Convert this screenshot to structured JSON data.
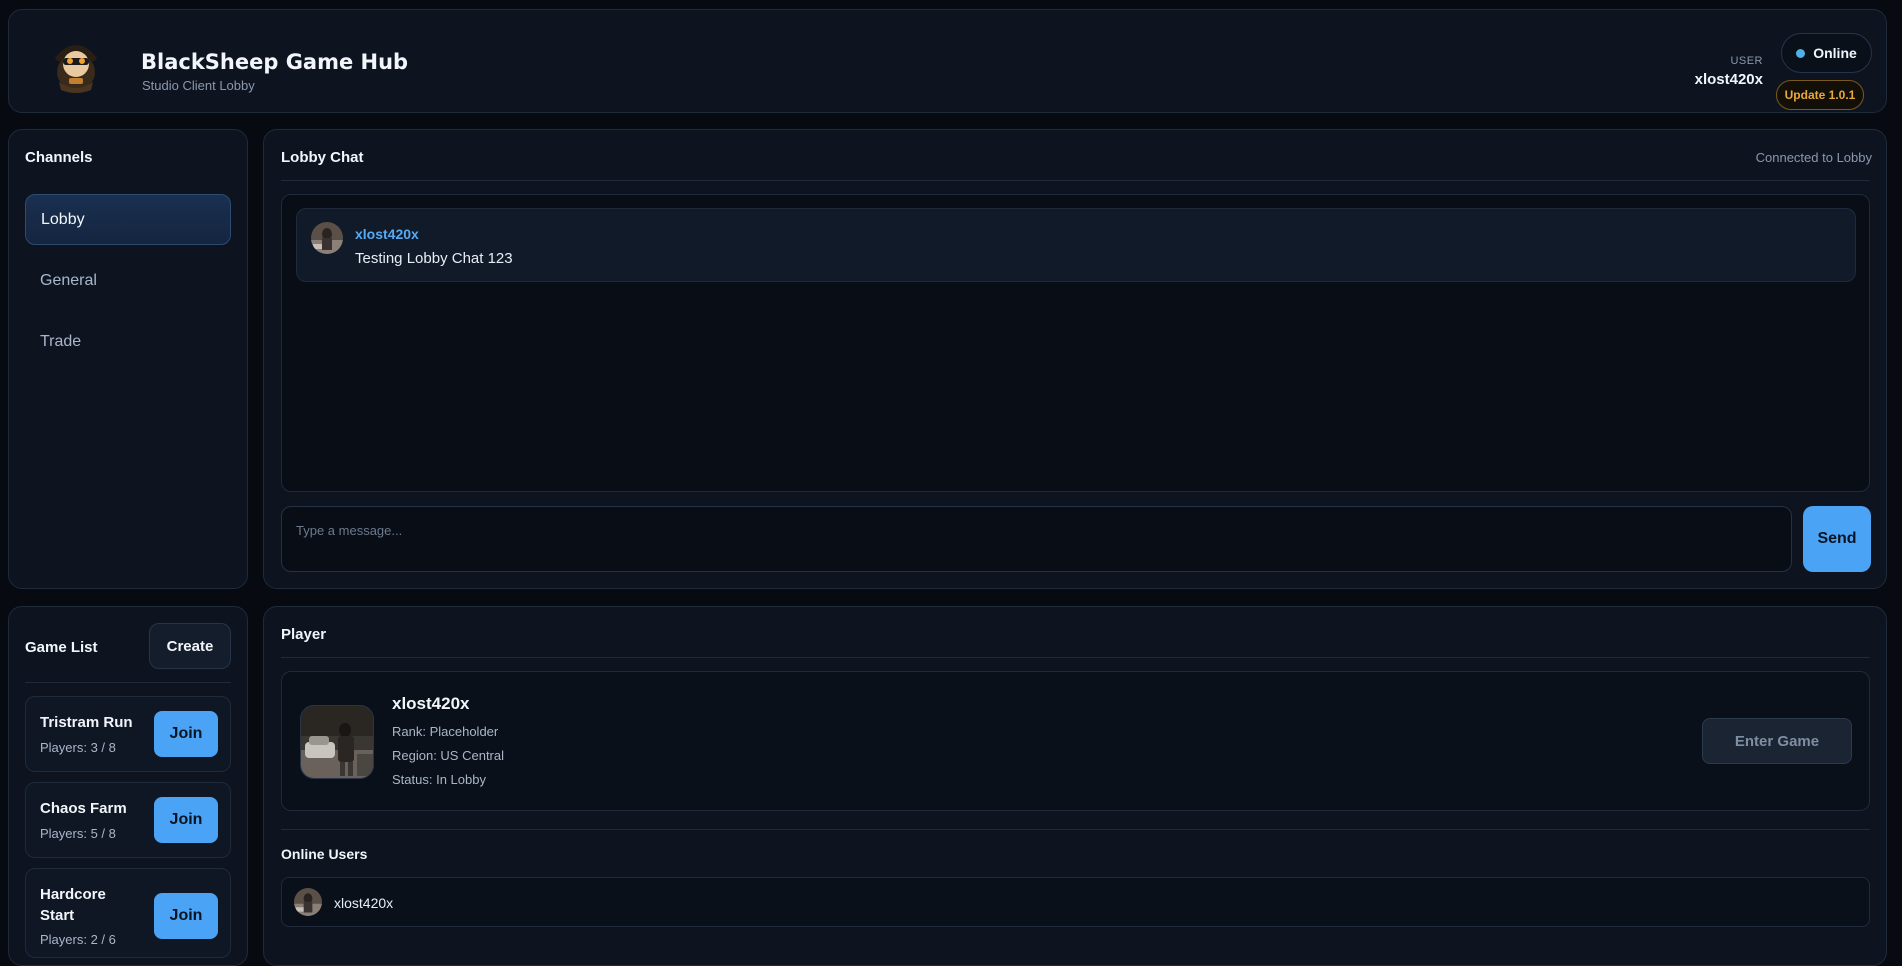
{
  "header": {
    "title": "BlackSheep Game Hub",
    "subtitle": "Studio Client Lobby",
    "user_label": "USER",
    "user_name": "xlost420x",
    "status": "Online",
    "update": "Update 1.0.1"
  },
  "channels": {
    "title": "Channels",
    "items": [
      {
        "label": "Lobby",
        "active": true
      },
      {
        "label": "General",
        "active": false
      },
      {
        "label": "Trade",
        "active": false
      }
    ]
  },
  "chat": {
    "title": "Lobby Chat",
    "status": "Connected to Lobby",
    "messages": [
      {
        "author": "xlost420x",
        "text": "Testing Lobby Chat 123"
      }
    ],
    "input_placeholder": "Type a message...",
    "send_label": "Send"
  },
  "games": {
    "title": "Game List",
    "create_label": "Create",
    "join_label": "Join",
    "items": [
      {
        "name": "Tristram Run",
        "players": "Players: 3 / 8"
      },
      {
        "name": "Chaos Farm",
        "players": "Players: 5 / 8"
      },
      {
        "name": "Hardcore Start",
        "players": "Players: 2 / 6"
      }
    ]
  },
  "player": {
    "title": "Player",
    "name": "xlost420x",
    "rank": "Rank: Placeholder",
    "region": "Region: US Central",
    "status": "Status: In Lobby",
    "enter_label": "Enter Game"
  },
  "online_users": {
    "title": "Online Users",
    "users": [
      {
        "name": "xlost420x"
      }
    ]
  },
  "colors": {
    "accent": "#4aa3f5",
    "status_dot": "#4fb0e8",
    "update": "#e8a93a",
    "background": "#070b11",
    "panel": "#0d1420"
  }
}
